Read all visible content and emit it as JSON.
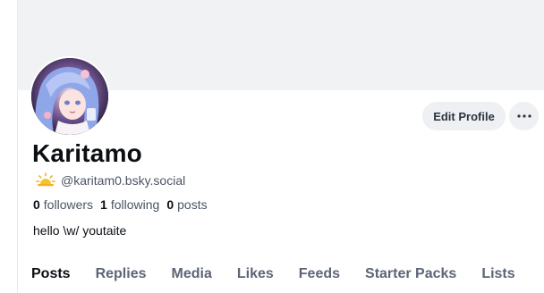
{
  "profile": {
    "display_name": "Karitamo",
    "handle": "@karitam0.bsky.social",
    "handle_icon": "sun-behind-cloud-icon",
    "followers_count": "0",
    "followers_label": "followers",
    "following_count": "1",
    "following_label": "following",
    "posts_count": "0",
    "posts_label": "posts",
    "bio": "hello \\w/ youtaite"
  },
  "actions": {
    "edit_profile_label": "Edit Profile",
    "more_icon": "more-horizontal-icon"
  },
  "tabs": [
    {
      "label": "Posts",
      "active": true
    },
    {
      "label": "Replies",
      "active": false
    },
    {
      "label": "Media",
      "active": false
    },
    {
      "label": "Likes",
      "active": false
    },
    {
      "label": "Feeds",
      "active": false
    },
    {
      "label": "Starter Packs",
      "active": false
    },
    {
      "label": "Lists",
      "active": false
    }
  ],
  "colors": {
    "banner": "#f1f2f4",
    "button_bg": "#eef0f3",
    "text_primary": "#0b0f14",
    "text_secondary": "#4b5563"
  }
}
